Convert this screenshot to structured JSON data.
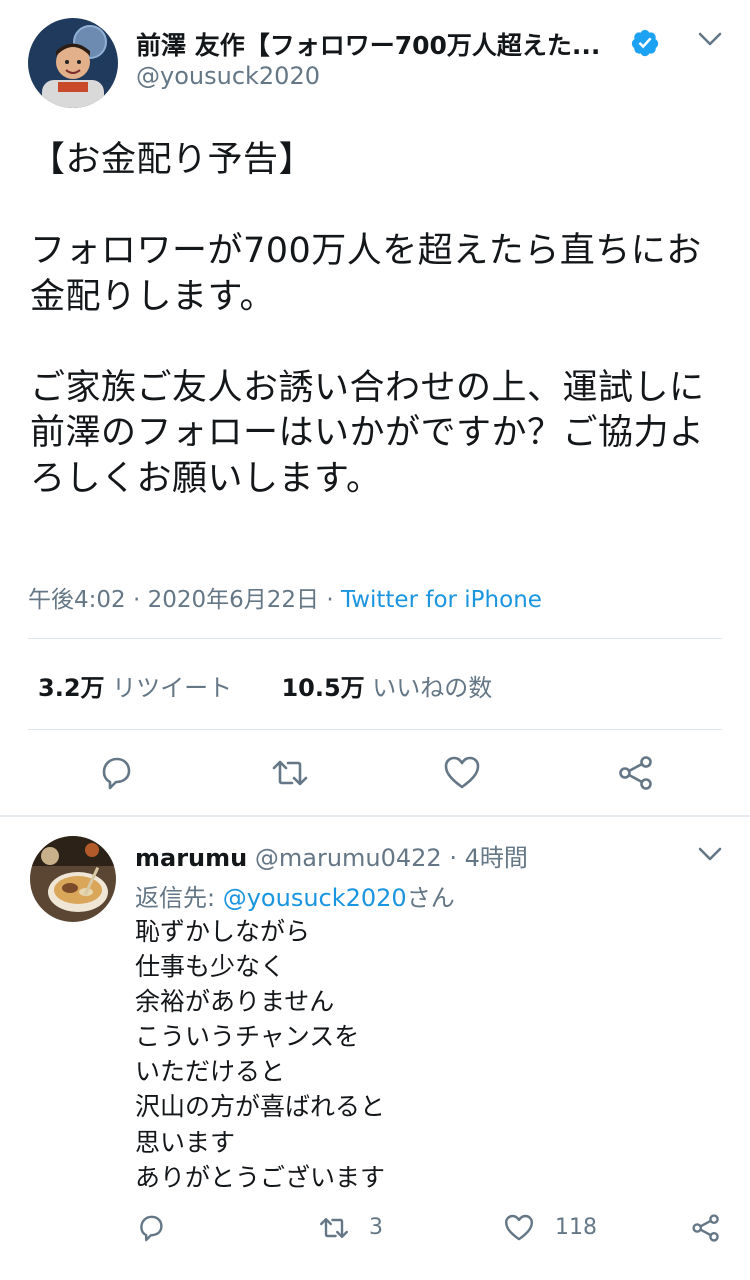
{
  "tweet": {
    "display_name": "前澤 友作【フォロワー700万人超えた...",
    "handle": "@yousuck2020",
    "text": "【お金配り予告】\n\nフォロワーが700万人を超えたら直ちにお金配りします。\n\nご家族ご友人お誘い合わせの上、運試しに前澤のフォローはいかがですか？ご協力よろしくお願いします。",
    "time": "午後4:02 · 2020年6月22日 ·",
    "source": "Twitter for iPhone",
    "retweets_count": "3.2万",
    "retweets_label": "リツイート",
    "likes_count": "10.5万",
    "likes_label": "いいねの数",
    "icons": [
      "reply-icon",
      "retweet-icon",
      "like-icon",
      "share-icon"
    ]
  },
  "reply": {
    "name": "marumu",
    "handle": "@marumu0422",
    "time": "· 4時間",
    "reply_to_prefix": "返信先: ",
    "reply_to_handle": "@yousuck2020",
    "reply_to_suffix": "さん",
    "text": "恥ずかしながら\n仕事も少なく\n余裕がありません\nこういうチャンスを\nいただけると\n沢山の方が喜ばれると\n思います\nありがとうございます",
    "retweets": "3",
    "likes": "118"
  },
  "colors": {
    "link": "#1b95e0",
    "muted": "#657786",
    "divider": "#e1e8ed",
    "text": "#14171a"
  }
}
